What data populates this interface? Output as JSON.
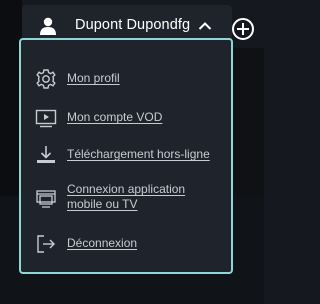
{
  "user": {
    "name": "Dupont Dupondfg"
  },
  "menu": {
    "items": [
      {
        "label": "Mon profil",
        "icon": "gear-icon"
      },
      {
        "label": "Mon compte VOD",
        "icon": "video-screen-icon"
      },
      {
        "label": "Téléchargement hors-ligne",
        "icon": "download-icon"
      },
      {
        "label": "Connexion application mobile ou TV",
        "icon": "devices-icon"
      },
      {
        "label": "Déconnexion",
        "icon": "logout-icon"
      }
    ]
  },
  "colors": {
    "accent_border": "#8fd6d6",
    "panel": "#1f232b",
    "text": "#c8ccd2"
  }
}
